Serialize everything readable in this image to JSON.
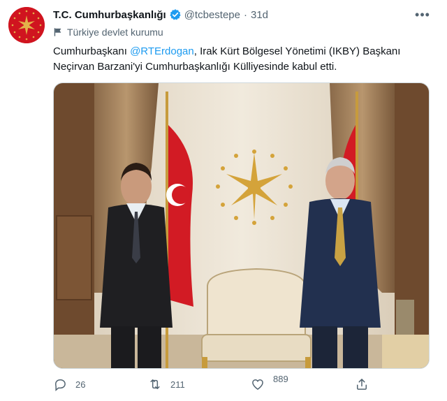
{
  "account": {
    "display_name": "T.C. Cumhurbaşkanlığı",
    "handle": "@tcbestepe",
    "separator": "·",
    "time": "31d",
    "label": "Türkiye devlet kurumu"
  },
  "tweet": {
    "text_before": "Cumhurbaşkanı ",
    "mention": "@RTErdogan",
    "text_after": ", Irak Kürt Bölgesel Yönetimi (IKBY) Başkanı Neçirvan Barzani'yi Cumhurbaşkanlığı Külliyesinde kabul etti."
  },
  "actions": {
    "replies": "26",
    "retweets": "211",
    "likes": "889"
  },
  "colors": {
    "accent": "#1d9bf0",
    "verified": "#1d9bf0",
    "secondary_text": "#536471",
    "emblem_red": "#d0141f",
    "emblem_gold": "#e3b14a"
  },
  "icons": {
    "more": "more-icon",
    "verified": "verified-badge-icon",
    "label": "flag-icon",
    "reply": "reply-icon",
    "retweet": "retweet-icon",
    "like": "heart-icon",
    "share": "share-icon"
  }
}
